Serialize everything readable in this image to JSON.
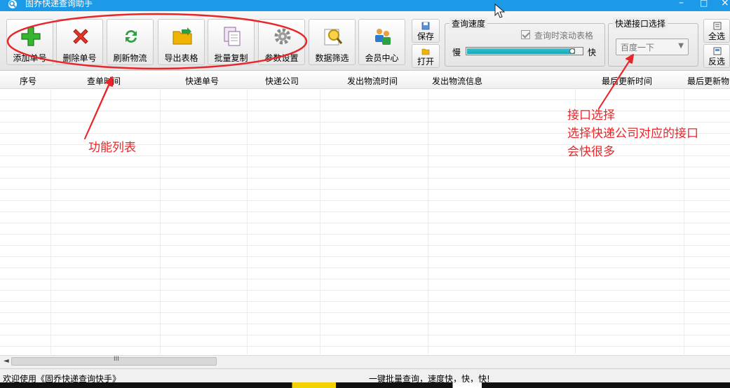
{
  "window": {
    "title": "固乔快递查询助手",
    "minimize_glyph": "–",
    "maximize_glyph": "□",
    "close_glyph": "×"
  },
  "toolbar": {
    "buttons": [
      {
        "label": "添加单号",
        "icon": "add-plus-icon"
      },
      {
        "label": "删除单号",
        "icon": "delete-x-icon"
      },
      {
        "label": "刷新物流",
        "icon": "refresh-icon"
      },
      {
        "label": "导出表格",
        "icon": "export-folder-icon"
      },
      {
        "label": "批量复制",
        "icon": "copy-documents-icon"
      },
      {
        "label": "参数设置",
        "icon": "gear-icon"
      },
      {
        "label": "数据筛选",
        "icon": "search-filter-icon"
      },
      {
        "label": "会员中心",
        "icon": "members-icon"
      }
    ],
    "save_label": "保存",
    "open_label": "打开"
  },
  "speed_group": {
    "legend": "查询速度",
    "scroll_checkbox_label": "查询时滚动表格",
    "scroll_checked": true,
    "slow_label": "慢",
    "fast_label": "快",
    "speed_level": 0.93
  },
  "api_group": {
    "legend": "快递接口选择",
    "selected": "百度一下"
  },
  "selection": {
    "select_all_label": "全选",
    "invert_label": "反选"
  },
  "table": {
    "columns": [
      "序号",
      "查单时间",
      "快递单号",
      "快递公司",
      "发出物流时间",
      "发出物流信息",
      "最后更新时间",
      "最后更新物"
    ]
  },
  "hscroll": {
    "left_arrow": "◄",
    "grip": "III"
  },
  "status": {
    "left_text": "欢迎使用《固乔快递查询快手》",
    "right_text": "一键批量查询，速度快，快，快!"
  },
  "annotations": {
    "function_list": "功能列表",
    "api_lines": [
      "接口选择",
      "选择快递公司对应的接口",
      "会快很多"
    ]
  },
  "colors": {
    "titlebar": "#1c9ae8",
    "annotation_red": "#e8262a",
    "slider_fill": "#1aa6b8"
  }
}
